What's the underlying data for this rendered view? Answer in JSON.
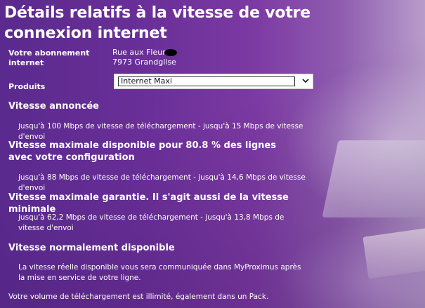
{
  "page": {
    "title": "Détails relatifs à la vitesse de votre connexion internet"
  },
  "subscription": {
    "label": "Votre abonnement internet",
    "street": "Rue aux Fleurs",
    "city": "7973 Grandglise"
  },
  "products": {
    "label": "Produits",
    "selected": "Internet Maxi"
  },
  "sections": [
    {
      "title": "Vitesse annoncée",
      "text": "jusqu'à  100 Mbps de vitesse de téléchargement - jusqu'à  15 Mbps de vitesse d'envoi"
    },
    {
      "title": "Vitesse maximale disponible pour 80.8 % des lignes avec votre configuration",
      "text": "jusqu'à  88 Mbps de vitesse de téléchargement - jusqu'à  14,6 Mbps de vitesse d'envoi"
    },
    {
      "title": "Vitesse maximale garantie. Il s'agit aussi de la vitesse minimale",
      "text": "jusqu'à  62,2 Mbps de vitesse de téléchargement - jusqu'à  13,8 Mbps de vitesse d'envoi"
    },
    {
      "title": "Vitesse normalement disponible",
      "text": "La vitesse réelle disponible vous sera communiquée dans MyProximus après la mise en service de votre ligne."
    }
  ],
  "footer": {
    "text": "Votre volume de téléchargement est illimité, également dans un Pack."
  },
  "colors": {
    "background": "#6a2f98",
    "text": "#ffffff"
  },
  "icons": {
    "dropdown": "chevron-down-icon"
  }
}
